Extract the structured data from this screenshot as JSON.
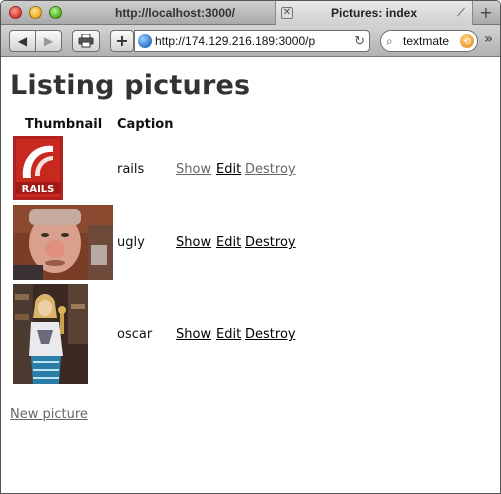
{
  "browser": {
    "tabs": [
      {
        "label": "http://localhost:3000/"
      },
      {
        "label": "Pictures: index"
      }
    ],
    "address": "http://174.129.216.189:3000/p",
    "search_value": "textmate"
  },
  "page": {
    "title": "Listing pictures",
    "headers": {
      "thumbnail": "Thumbnail",
      "caption": "Caption"
    },
    "rows": [
      {
        "caption": "rails",
        "logo_text": "RAILS",
        "show": "Show",
        "edit": "Edit",
        "destroy": "Destroy"
      },
      {
        "caption": "ugly",
        "show": "Show",
        "edit": "Edit",
        "destroy": "Destroy"
      },
      {
        "caption": "oscar",
        "show": "Show",
        "edit": "Edit",
        "destroy": "Destroy"
      }
    ],
    "new_link": "New picture"
  }
}
